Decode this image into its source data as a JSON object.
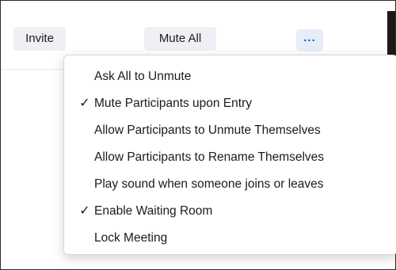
{
  "toolbar": {
    "invite_label": "Invite",
    "mute_all_label": "Mute All",
    "more_label": "..."
  },
  "menu": {
    "items": [
      {
        "label": "Ask All to Unmute",
        "checked": false
      },
      {
        "label": "Mute Participants upon Entry",
        "checked": true
      },
      {
        "label": "Allow Participants to Unmute Themselves",
        "checked": false
      },
      {
        "label": "Allow Participants to Rename Themselves",
        "checked": false
      },
      {
        "label": "Play sound when someone joins or leaves",
        "checked": false
      },
      {
        "label": "Enable Waiting Room",
        "checked": true
      },
      {
        "label": "Lock Meeting",
        "checked": false
      }
    ],
    "check_glyph": "✓"
  }
}
